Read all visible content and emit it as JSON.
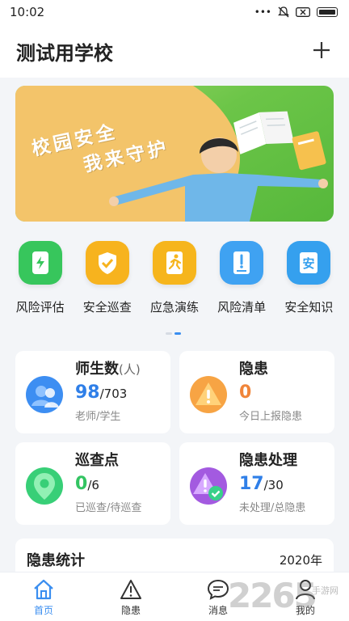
{
  "status_bar": {
    "time": "10:02"
  },
  "header": {
    "title": "测试用学校"
  },
  "banner": {
    "line1": "校园安全",
    "line2": "我来守护"
  },
  "quick_menu": [
    {
      "label": "风险评估",
      "color": "#37c65c",
      "icon": "lightning-phone-icon"
    },
    {
      "label": "安全巡查",
      "color": "#f7b31e",
      "icon": "shield-check-icon"
    },
    {
      "label": "应急演练",
      "color": "#f6b51c",
      "icon": "running-man-icon"
    },
    {
      "label": "风险清单",
      "color": "#3fa2f2",
      "icon": "list-warning-icon"
    },
    {
      "label": "安全知识",
      "color": "#35a0ee",
      "icon": "safety-book-icon"
    }
  ],
  "cards": {
    "students": {
      "title": "师生数",
      "unit": "(人)",
      "value": "98",
      "total": "/703",
      "sub": "老师/学生",
      "value_color": "#2f7fe8"
    },
    "hazards": {
      "title": "隐患",
      "value": "0",
      "sub": "今日上报隐患",
      "value_color": "#f0853a"
    },
    "patrol": {
      "title": "巡查点",
      "value": "0",
      "total": "/6",
      "sub": "已巡查/待巡查",
      "value_color": "#33c462"
    },
    "handling": {
      "title": "隐患处理",
      "value": "17",
      "total": "/30",
      "sub": "未处理/总隐患",
      "value_color": "#2f7fe8"
    }
  },
  "stats": {
    "title": "隐患统计",
    "year": "2020年"
  },
  "tabbar": [
    {
      "label": "首页",
      "icon": "home-icon",
      "active": true
    },
    {
      "label": "隐患",
      "icon": "warning-icon",
      "active": false
    },
    {
      "label": "消息",
      "icon": "message-icon",
      "active": false
    },
    {
      "label": "我的",
      "icon": "user-icon",
      "active": false
    }
  ],
  "watermark": {
    "text": "2265",
    "sub": "手游网"
  }
}
